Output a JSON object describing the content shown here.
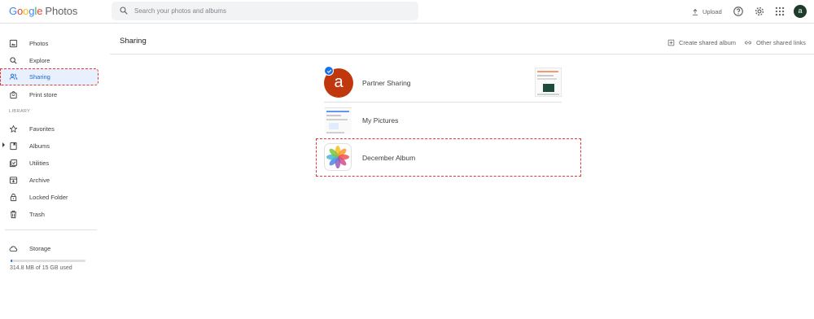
{
  "app": {
    "logo_google": "Google",
    "logo_photos": "Photos"
  },
  "search": {
    "placeholder": "Search your photos and albums"
  },
  "header": {
    "upload_label": "Upload",
    "avatar_letter": "a"
  },
  "sidebar": {
    "items": [
      {
        "label": "Photos",
        "icon": "photo-icon"
      },
      {
        "label": "Explore",
        "icon": "search-icon"
      },
      {
        "label": "Sharing",
        "icon": "people-icon",
        "active": true
      },
      {
        "label": "Print store",
        "icon": "shopping-bag-icon"
      }
    ],
    "library_label": "LIBRARY",
    "library_items": [
      {
        "label": "Favorites",
        "icon": "star-icon"
      },
      {
        "label": "Albums",
        "icon": "album-icon"
      },
      {
        "label": "Utilities",
        "icon": "checkbox-icon"
      },
      {
        "label": "Archive",
        "icon": "archive-icon"
      },
      {
        "label": "Locked Folder",
        "icon": "lock-icon"
      },
      {
        "label": "Trash",
        "icon": "trash-icon"
      }
    ],
    "storage": {
      "label": "Storage",
      "used_text": "314.8 MB of 15 GB used",
      "used_fraction": 0.02
    }
  },
  "main": {
    "title": "Sharing",
    "create_album_label": "Create shared album",
    "other_links_label": "Other shared links",
    "rows": [
      {
        "label": "Partner Sharing",
        "avatar_letter": "a"
      },
      {
        "label": "My Pictures"
      },
      {
        "label": "December Album"
      }
    ]
  },
  "colors": {
    "accent": "#1a73e8",
    "active_bg": "#e8f0fe",
    "highlight": "#e53935",
    "avatar_brand": "#c0370e"
  }
}
